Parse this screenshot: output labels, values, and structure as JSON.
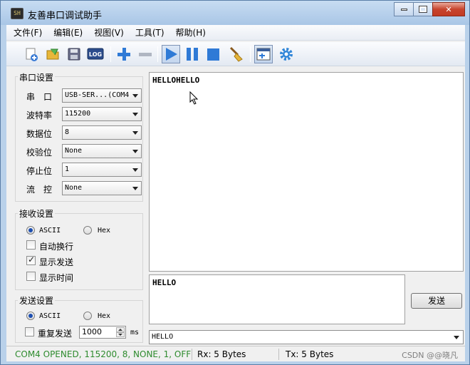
{
  "window": {
    "app_icon_text": "SH",
    "title": "友善串口调试助手"
  },
  "menu": [
    "文件(F)",
    "编辑(E)",
    "视图(V)",
    "工具(T)",
    "帮助(H)"
  ],
  "toolbar": {
    "icons": [
      "new-file-icon",
      "open-folder-icon",
      "save-icon",
      "log-icon",
      "add-icon",
      "remove-icon",
      "play-icon",
      "pause-icon",
      "stop-icon",
      "clear-broom-icon",
      "new-window-icon",
      "settings-gear-icon"
    ],
    "log_text": "LOG"
  },
  "serial": {
    "title": "串口设置",
    "fields": [
      {
        "label": "串　口",
        "value": "USB-SER...(COM4"
      },
      {
        "label": "波特率",
        "value": "115200"
      },
      {
        "label": "数据位",
        "value": "8"
      },
      {
        "label": "校验位",
        "value": "None"
      },
      {
        "label": "停止位",
        "value": "1"
      },
      {
        "label": "流　控",
        "value": "None"
      }
    ]
  },
  "receive": {
    "title": "接收设置",
    "ascii": "ASCII",
    "hex": "Hex",
    "mode": "ASCII",
    "options": [
      {
        "label": "自动换行",
        "checked": false
      },
      {
        "label": "显示发送",
        "checked": true
      },
      {
        "label": "显示时间",
        "checked": false
      }
    ]
  },
  "send_settings": {
    "title": "发送设置",
    "ascii": "ASCII",
    "hex": "Hex",
    "mode": "ASCII",
    "repeat_label": "重复发送",
    "repeat_checked": false,
    "interval": "1000",
    "unit": "ms"
  },
  "receive_text": "HELLOHELLO",
  "send_text": "HELLO",
  "send_button": "发送",
  "history_value": "HELLO",
  "status": {
    "port": "COM4 OPENED, 115200, 8, NONE, 1, OFF",
    "rx": "Rx: 5 Bytes",
    "tx": "Tx: 5 Bytes",
    "watermark": "CSDN @@晓凡",
    "port_color": "#2e8b2e"
  }
}
